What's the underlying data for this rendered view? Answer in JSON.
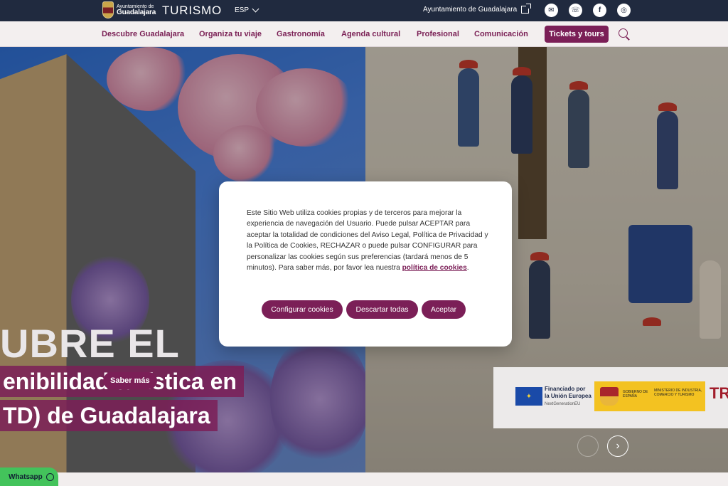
{
  "topbar": {
    "brand_small": "Ayuntamiento de",
    "brand_big": "Guadalajara",
    "title": "TURISMO",
    "language": "ESP",
    "ayuntamiento_link": "Ayuntamiento de Guadalajara",
    "socials": [
      {
        "icon": "mail-icon",
        "glyph": "✉"
      },
      {
        "icon": "whatsapp-icon",
        "glyph": "☏"
      },
      {
        "icon": "facebook-icon",
        "glyph": "f"
      },
      {
        "icon": "instagram-icon",
        "glyph": "◎"
      }
    ]
  },
  "nav": {
    "items": [
      "Descubre Guadalajara",
      "Organiza tu viaje",
      "Gastronomía",
      "Agenda cultural",
      "Profesional",
      "Comunicación"
    ],
    "tickets": "Tickets y tours"
  },
  "hero": {
    "title_fragment": "UBRE EL",
    "line1": "enibilidad turística en",
    "line2": "TD) de Guadalajara",
    "cta": "Saber más"
  },
  "funding": {
    "eu_line1": "Financiado por",
    "eu_line2": "la Unión Europea",
    "eu_sub": "NextGenerationEU",
    "gob_left": "GOBIERNO DE ESPAÑA",
    "gob_right": "MINISTERIO DE INDUSTRIA, COMERCIO Y TURISMO",
    "tr_logo": "TR"
  },
  "whatsapp": "Whatsapp",
  "cookie": {
    "text": "Este Sitio Web utiliza cookies propias y de terceros para mejorar la experiencia de navegación del Usuario. Puede pulsar ACEPTAR para aceptar la totalidad de condiciones del Aviso Legal, Política de Privacidad y la Política de Cookies, RECHAZAR o puede pulsar CONFIGURAR para personalizar las cookies según sus preferencias (tardará menos de 5 minutos). Para saber más, por favor lea nuestra",
    "link": "política de cookies",
    "buttons": {
      "configure": "Configurar cookies",
      "reject": "Descartar todas",
      "accept": "Aceptar"
    }
  },
  "colors": {
    "brand": "#7b1f57",
    "topbar": "#202a3f",
    "whatsapp": "#43c35b"
  }
}
